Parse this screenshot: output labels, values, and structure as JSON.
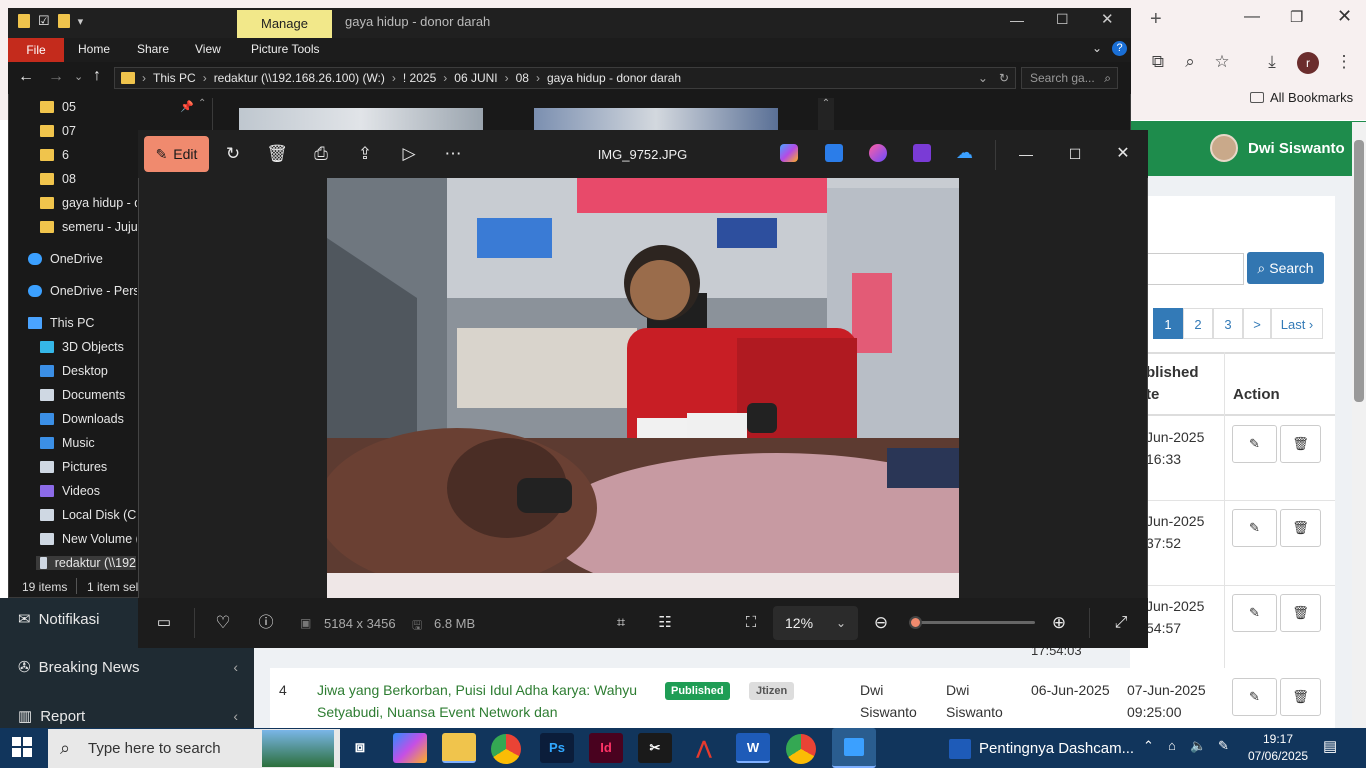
{
  "browser": {
    "bookmarks_label": "All Bookmarks",
    "profile_initial": "r"
  },
  "admin": {
    "user_name": "Dwi Siswanto",
    "search_button": "Search",
    "pagination": [
      "1",
      "2",
      "3",
      ">",
      "Last ›"
    ],
    "col_published": "blished\nte",
    "col_published_line1": "blished",
    "col_published_line2": "te",
    "col_action": "Action",
    "rows_partial": [
      {
        "date1": "Jun-2025",
        "date2": "16:33"
      },
      {
        "date1": "Jun-2025",
        "date2": "37:52"
      },
      {
        "date1": "Jun-2025",
        "date2": "54:57"
      }
    ],
    "row_partial_extra_time": "17:54:03",
    "row4": {
      "num": "4",
      "title": "Jiwa yang Berkorban, Puisi Idul Adha karya: Wahyu Setyabudi, Nuansa Event Network dan",
      "status": "Published",
      "category": "Jtizen",
      "author": "Dwi Siswanto",
      "editor": "Dwi Siswanto",
      "created": "06-Jun-2025",
      "published": "07-Jun-2025 09:25:00"
    }
  },
  "sidebar": {
    "items": [
      {
        "label": "Notifikasi",
        "icon": "envelope-icon"
      },
      {
        "label": "Breaking News",
        "icon": "bell-icon"
      },
      {
        "label": "Report",
        "icon": "chart-icon"
      }
    ]
  },
  "explorer": {
    "manage_tab": "Manage",
    "title": "gaya hidup - donor darah",
    "tabs": [
      "File",
      "Home",
      "Share",
      "View",
      "Picture Tools"
    ],
    "breadcrumb": [
      "This PC",
      "redaktur (\\\\192.168.26.100) (W:)",
      "! 2025",
      "06 JUNI",
      "08",
      "gaya hidup - donor darah"
    ],
    "search_placeholder": "Search ga...",
    "nav": [
      {
        "label": "05",
        "type": "folder"
      },
      {
        "label": "07",
        "type": "folder"
      },
      {
        "label": "6",
        "type": "folder"
      },
      {
        "label": "08",
        "type": "folder"
      },
      {
        "label": "gaya hidup - d",
        "type": "folder"
      },
      {
        "label": "semeru - Jujug",
        "type": "folder"
      },
      {
        "label": "OneDrive",
        "type": "cloud"
      },
      {
        "label": "OneDrive - Perso",
        "type": "cloud"
      },
      {
        "label": "This PC",
        "type": "pc"
      },
      {
        "label": "3D Objects",
        "type": "cube"
      },
      {
        "label": "Desktop",
        "type": "desktop"
      },
      {
        "label": "Documents",
        "type": "doc"
      },
      {
        "label": "Downloads",
        "type": "download"
      },
      {
        "label": "Music",
        "type": "music"
      },
      {
        "label": "Pictures",
        "type": "pictures"
      },
      {
        "label": "Videos",
        "type": "videos"
      },
      {
        "label": "Local Disk (C:)",
        "type": "disk"
      },
      {
        "label": "New Volume (D",
        "type": "disk"
      },
      {
        "label": "redaktur (\\\\192",
        "type": "netdrive"
      }
    ],
    "status_items": "19 items",
    "status_selected": "1 item sel"
  },
  "photos": {
    "edit_label": "Edit",
    "filename": "IMG_9752.JPG",
    "dimensions": "5184 x 3456",
    "filesize": "6.8 MB",
    "zoom": "12%",
    "zoom_level": 0.05
  },
  "taskbar": {
    "search_placeholder": "Type here to search",
    "active_window": "Pentingnya Dashcam...",
    "time": "19:17",
    "date": "07/06/2025"
  },
  "colors": {
    "admin_green": "#1e8c4c",
    "search_blue": "#3276b1",
    "published_badge": "#1f9d55",
    "edit_accent": "#f08a6e"
  }
}
